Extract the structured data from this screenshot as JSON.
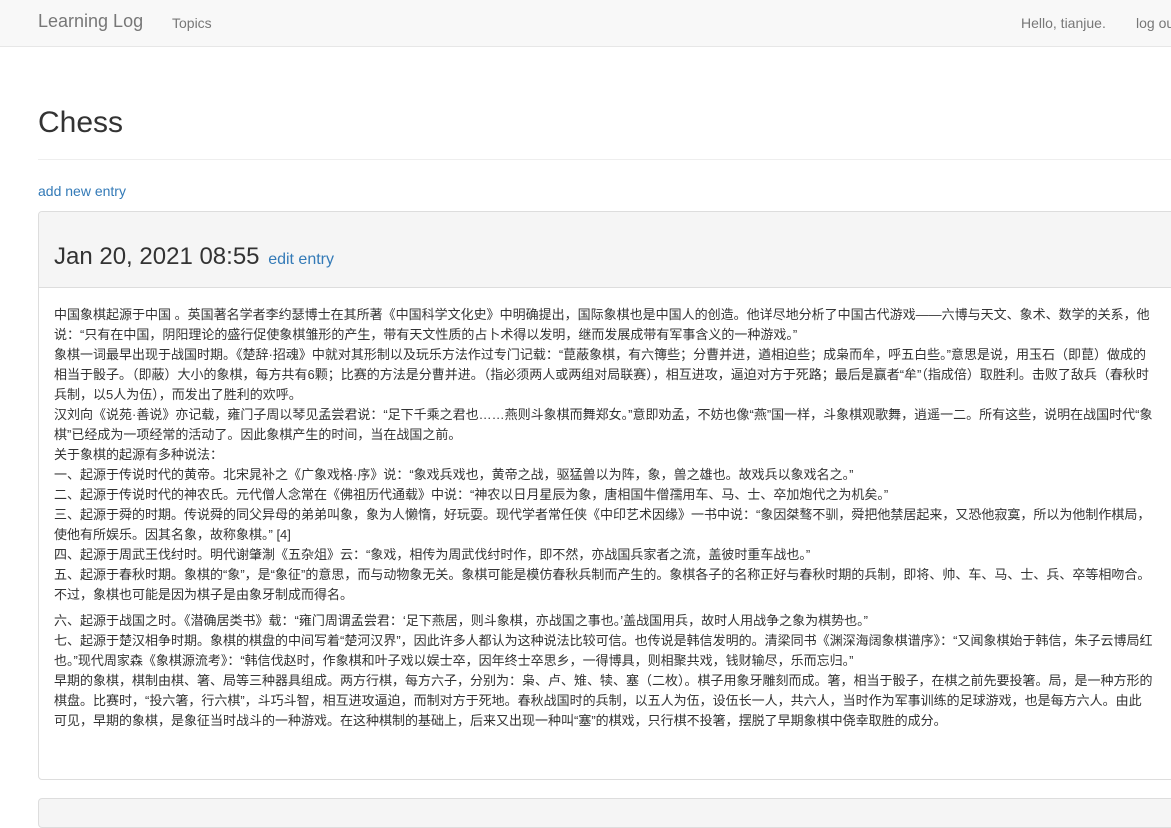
{
  "navbar": {
    "brand": "Learning Log",
    "topics_label": "Topics",
    "greeting": "Hello, tianjue.",
    "logout_label": "log out"
  },
  "page": {
    "title": "Chess",
    "add_entry_label": "add new entry"
  },
  "entry": {
    "date": "Jan 20, 2021 08:55",
    "edit_label": "edit entry",
    "paragraphs": [
      "中国象棋起源于中国 。英国著名学者李约瑟博士在其所著《中国科学文化史》中明确提出，国际象棋也是中国人的创造。他详尽地分析了中国古代游戏——六博与天文、象术、数学的关系，他说：“只有在中国，阴阳理论的盛行促使象棋雏形的产生，带有天文性质的占卜术得以发明，继而发展成带有军事含义的一种游戏。”",
      "象棋一词最早出现于战国时期。《楚辞·招魂》中就对其形制以及玩乐方法作过专门记载：“菎蔽象棋，有六簙些；分曹并进，遒相迫些；成枭而牟，呼五白些。”意思是说，用玉石（即菎）做成的相当于骰子。（即蔽）大小的象棋，每方共有6颗；比赛的方法是分曹并进。（指必须两人或两组对局联赛），相互进攻，逼迫对方于死路；最后是赢者“牟”（指成倍）取胜利。击败了敌兵（春秋时兵制，以5人为伍），而发出了胜利的欢呼。",
      "汉刘向《说苑·善说》亦记载，雍门子周以琴见孟尝君说：“足下千乘之君也……燕则斗象棋而舞郑女。”意即劝孟，不妨也像“燕”国一样，斗象棋观歌舞，逍遥一二。所有这些，说明在战国时代“象棋”已经成为一项经常的活动了。因此象棋产生的时间，当在战国之前。",
      "关于象棋的起源有多种说法：",
      "一、起源于传说时代的黄帝。北宋晁补之《广象戏格·序》说：“象戏兵戏也，黄帝之战，驱猛兽以为阵，象，兽之雄也。故戏兵以象戏名之。”",
      "二、起源于传说时代的神农氏。元代僧人念常在《佛祖历代通载》中说：“神农以日月星辰为象，唐相国牛僧孺用车、马、士、卒加炮代之为机矣。”",
      "三、起源于舜的时期。传说舜的同父异母的弟弟叫象，象为人懒惰，好玩耍。现代学者常任侠《中印艺术因缘》一书中说：“象因桀骜不驯，舜把他禁居起来，又恐他寂寞，所以为他制作棋局，使他有所娱乐。因其名象，故称象棋。” [4]",
      "四、起源于周武王伐纣时。明代谢肇淛《五杂俎》云：“象戏，相传为周武伐纣时作，即不然，亦战国兵家者之流，盖彼时重车战也。”",
      "五、起源于春秋时期。象棋的“象”，是“象征”的意思，而与动物象无关。象棋可能是模仿春秋兵制而产生的。象棋各子的名称正好与春秋时期的兵制，即将、帅、车、马、士、兵、卒等相吻合。不过，象棋也可能是因为棋子是由象牙制成而得名。",
      "六、起源于战国之时。《潜确居类书》载：“雍门周谓孟尝君：‘足下燕居，则斗象棋，亦战国之事也。’盖战国用兵，故时人用战争之象为棋势也。”",
      "七、起源于楚汉相争时期。象棋的棋盘的中间写着“楚河汉界”，因此许多人都认为这种说法比较可信。也传说是韩信发明的。清梁同书《渊深海阔象棋谱序》：“又闻象棋始于韩信，朱子云博局红也。”现代周家森《象棋源流考》：“韩信伐赵时，作象棋和叶子戏以娱士卒，因年终士卒思乡，一得博具，则相聚共戏，钱财输尽，乐而忘归。”",
      "早期的象棋，棋制由棋、箸、局等三种器具组成。两方行棋，每方六子，分别为：枭、卢、雉、犊、塞（二枚）。棋子用象牙雕刻而成。箸，相当于骰子，在棋之前先要投箸。局，是一种方形的棋盘。比赛时，“投六箸，行六棋”，斗巧斗智，相互进攻逼迫，而制对方于死地。春秋战国时的兵制，以五人为伍，设伍长一人，共六人，当时作为军事训练的足球游戏，也是每方六人。由此可见，早期的象棋，是象征当时战斗的一种游戏。在这种棋制的基础上，后来又出现一种叫“塞”的棋戏，只行棋不投箸，摆脱了早期象棋中侥幸取胜的成分。"
    ]
  }
}
